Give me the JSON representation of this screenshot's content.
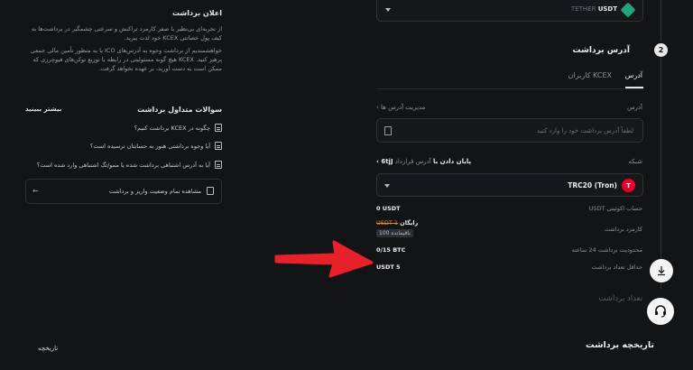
{
  "left": {
    "notice": {
      "title": "اعلان برداشت",
      "para1": "از تجربه‌ای بی‌نظیر با صفر کارمزد تراکنش و سرعتی چشمگیر در برداشت‌ها به کیف پول خصانتی KCEX خود لذت ببرید.",
      "para2": "خواهشمندیم از برداشت وجوه به آدرس‌های ICO یا به منظور تأمین مالی جمعی پرهیز کنید. KCEX هیچ گونه مسئولیتی در رابطه با توزیع توکن‌های فیوچرزی که ممکن است به دست آورید، بر عهده نخواهد گرفت."
    },
    "faq": {
      "title": "سوالات متداول برداشت",
      "more": "بیشتر ببینید",
      "items": [
        "چگونه در KCEX برداشت کنیم؟",
        "آیا وجوه برداشتی هنوز به حسابتان نرسیده است؟",
        "آیا به آدرس اشتباهی برداشت شده یا ممو/تگ اشتباهی وارد شده است؟"
      ],
      "status_link": "مشاهده تمام وضعیت واریز و برداشت"
    },
    "history_tab": "تاریخچه"
  },
  "right": {
    "coin": {
      "name": "USDT",
      "full": "TETHER"
    },
    "step2": {
      "num": "2",
      "title": "آدرس برداشت"
    },
    "tabs": [
      "آدرس",
      "کاربران KCEX"
    ],
    "address": {
      "label": "آدرس",
      "manage": "مدیریت آدرس ها",
      "placeholder": "لطفاً آدرس برداشت خود را وارد کنید"
    },
    "network": {
      "label": "شبکه",
      "contract_label": "آدرس قرارداد",
      "contract_value": "پایان دادن با",
      "contract_suffix": "6tjJ",
      "selected": "TRC20 (Tron)",
      "icon_letter": "T"
    },
    "info": [
      {
        "label": "USDT حساب اکوئیتی",
        "value": "0 USDT"
      },
      {
        "label": "کارمزد برداشت",
        "value": "رایگان",
        "strike": "USDT 1",
        "badge": "باقیمانده 100"
      },
      {
        "label": "محدودیت برداشت 24 ساعته",
        "value": "0/15 BTC"
      },
      {
        "label": "حداقل تعداد برداشت",
        "value": "USDT 5"
      }
    ],
    "step3": {
      "num": "3",
      "title": "تعداد برداشت"
    },
    "history_title": "تاریخچه برداشت"
  },
  "colors": {
    "accent": "#eb0029",
    "tether": "#26a17b",
    "arrow": "#e8202a"
  }
}
